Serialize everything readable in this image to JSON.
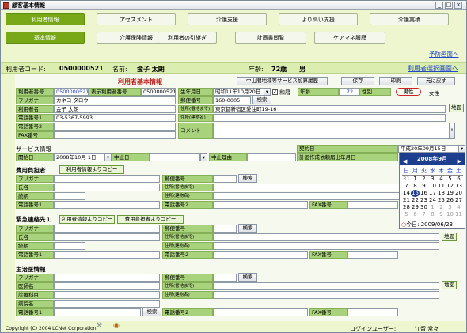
{
  "window": {
    "title": "顧客基本情報"
  },
  "tabs1": [
    "利用者情報",
    "アセスメント",
    "介護支援",
    "より高い支援",
    "介護実積"
  ],
  "tabs2": [
    "基本情報",
    "介護保険情報",
    "利用者の引継ぎ",
    "計画書閲覧",
    "ケアマネ履歴"
  ],
  "links": {
    "yobou": "予防画面へ",
    "select": "利用者選択画面へ"
  },
  "header": {
    "code_label": "利用者コード:",
    "code": "0500000521",
    "name_label": "名前:",
    "name": "金子 太朗",
    "age_label": "年齢:",
    "age": "72歳",
    "sex": "男"
  },
  "panel": {
    "title": "利用者基本情報",
    "btn_service": "中山間地域等サービス加算履歴",
    "btn_save": "保存",
    "btn_print": "印刷",
    "btn_back": "元に戻す",
    "btn_map": "地図",
    "btn_search": "検索"
  },
  "basic": {
    "l_no": "利用者番号",
    "v_no": "0500000521",
    "l_disp": "表示利用者番号",
    "v_disp": "0500000521",
    "l_birth": "生年月日",
    "v_birth": "昭和11年10月20日",
    "l_era": "和暦",
    "l_age": "年齢",
    "v_age": "72",
    "l_sex": "性別",
    "v_male": "男性",
    "v_female": "女性",
    "l_kana": "フリガナ",
    "v_kana": "カネコ タロウ",
    "l_zip": "郵便番号",
    "v_zip": "160-0005",
    "l_name": "利用者名",
    "v_name": "金子 太朗",
    "l_addr1": "住所(番地まで)",
    "v_addr1": "東京都新宿区愛住町19-16",
    "l_tel1": "電話番号1",
    "v_tel1": "03-5367-5993",
    "l_addr2": "住所(建物名)",
    "l_tel2": "電話番号2",
    "l_comment": "コメント",
    "l_fax": "FAX番号"
  },
  "service": {
    "title": "サービス情報",
    "l_start": "開始日",
    "v_start": "2008年10月 1日",
    "l_stop": "中止日",
    "l_reason": "中止理由",
    "l_contract": "契約日",
    "v_contract": "平成20年09月15日",
    "l_plan": "計画作成依頼届出年月日"
  },
  "payer": {
    "title": "費用負担者",
    "copy": "利用者情報よりコピー",
    "l_kana": "フリガナ",
    "l_zip": "郵便番号",
    "l_name": "氏名",
    "l_addr1": "住所(番地まで)",
    "l_rel": "続柄",
    "l_addr2": "住所(建物名)",
    "l_tel1": "電話番号1",
    "l_tel2": "電話番号2",
    "l_fax": "FAX番号"
  },
  "emergency": {
    "title": "緊急連絡先１",
    "copy1": "利用者情報よりコピー",
    "copy2": "費用負担者よりコピー",
    "l_kana": "フリガナ",
    "l_zip": "郵便番号",
    "l_name": "氏名",
    "l_addr1": "住所(番地まで)",
    "l_rel": "続柄",
    "l_addr2": "住所(建物名)",
    "l_tel1": "電話番号1",
    "l_tel2": "電話番号2",
    "l_fax": "FAX番号"
  },
  "doctor": {
    "title": "主治医情報",
    "l_kana": "フリガナ",
    "l_zip": "郵便番号",
    "l_doc": "医師名",
    "l_addr1": "住所(番地まで)",
    "l_dept": "診療科目",
    "l_addr2": "住所(建物名)",
    "l_hosp": "病院名",
    "l_tel1": "電話番号1",
    "l_tel2": "電話番号2",
    "l_fax": "FAX番号"
  },
  "calendar": {
    "month": "2008年9月",
    "days": [
      "日",
      "月",
      "火",
      "水",
      "木",
      "金",
      "土"
    ],
    "weeks": [
      [
        "31",
        "1",
        "2",
        "3",
        "4",
        "5",
        "6"
      ],
      [
        "7",
        "8",
        "9",
        "10",
        "11",
        "12",
        "13"
      ],
      [
        "14",
        "15",
        "16",
        "17",
        "18",
        "19",
        "20"
      ],
      [
        "21",
        "22",
        "23",
        "24",
        "25",
        "26",
        "27"
      ],
      [
        "28",
        "29",
        "30",
        "1",
        "2",
        "3",
        "4"
      ],
      [
        "5",
        "6",
        "7",
        "8",
        "9",
        "10",
        "11"
      ]
    ],
    "selected": "15",
    "today": "今日: 2009/06/23"
  },
  "footer": {
    "copyright": "Copyright (C) 2004 LCNet Corporation",
    "login_label": "ログインユーザー:",
    "login_user": "江留 常々"
  },
  "colors": {
    "tab": "#8ac21f",
    "label": "#a9d27c",
    "bg": "#eef6cf",
    "calhead": "#1d3d8f"
  }
}
